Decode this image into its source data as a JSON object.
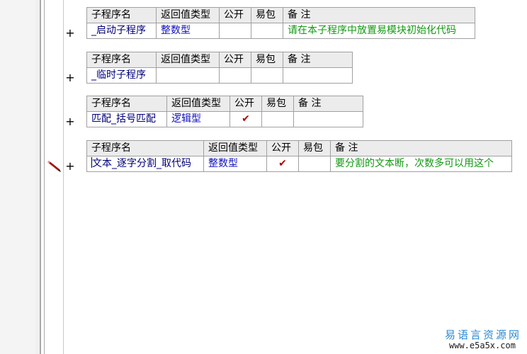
{
  "headers": {
    "name": "子程序名",
    "return_type": "返回值类型",
    "public": "公开",
    "easy_pack": "易包",
    "note": "备 注"
  },
  "expand_symbol": "+",
  "check_mark": "✔",
  "subroutines": [
    {
      "name": "_启动子程序",
      "return_type": "整数型",
      "public": "",
      "easy_pack": "",
      "note": "请在本子程序中放置易模块初始化代码"
    },
    {
      "name": "_临时子程序",
      "return_type": "",
      "public": "",
      "easy_pack": "",
      "note": ""
    },
    {
      "name": "匹配_括号匹配",
      "return_type": "逻辑型",
      "public": true,
      "easy_pack": "",
      "note": ""
    },
    {
      "name": "文本_逐字分割_取代码",
      "return_type": "整数型",
      "public": true,
      "easy_pack": "",
      "note": "要分割的文本断，次数多可以用这个"
    }
  ],
  "watermark": {
    "site_name": "易语言资源网",
    "url": "www.e5a5x.com"
  },
  "colors": {
    "header_bg": "#ececec",
    "border": "#a0a0a0",
    "name_text": "#00007b",
    "type_text": "#1010c0",
    "note_text": "#119911",
    "check": "#b00000",
    "watermark": "#2c8ad6"
  },
  "icons": {
    "edit_marker": "pencil-icon",
    "public_check": "check-icon"
  }
}
